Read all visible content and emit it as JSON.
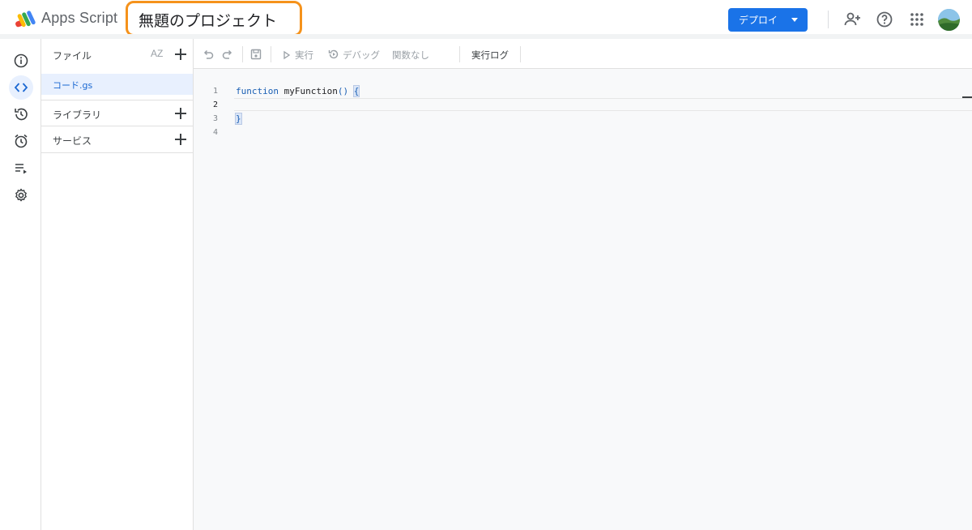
{
  "header": {
    "app_name": "Apps Script",
    "project_title": "無題のプロジェクト",
    "deploy_label": "デプロイ",
    "accent_color": "#1a73e8",
    "highlight_color": "#f5921b"
  },
  "rail": {
    "items": [
      {
        "icon": "info-icon",
        "active": false
      },
      {
        "icon": "code-icon",
        "active": true
      },
      {
        "icon": "history-icon",
        "active": false
      },
      {
        "icon": "alarm-icon",
        "active": false
      },
      {
        "icon": "executions-icon",
        "active": false
      },
      {
        "icon": "gear-icon",
        "active": false
      }
    ]
  },
  "files_panel": {
    "files_label": "ファイル",
    "sort_label": "AZ",
    "files": [
      {
        "name": "コード.gs",
        "selected": true
      }
    ],
    "libraries_label": "ライブラリ",
    "services_label": "サービス"
  },
  "toolbar": {
    "run_label": "実行",
    "debug_label": "デバッグ",
    "function_label": "関数なし",
    "log_label": "実行ログ"
  },
  "editor": {
    "line_numbers": [
      "1",
      "2",
      "3",
      "4"
    ],
    "code": {
      "keyword": "function",
      "function_name": "myFunction",
      "parens": "()",
      "open_brace": "{",
      "close_brace": "}"
    }
  }
}
